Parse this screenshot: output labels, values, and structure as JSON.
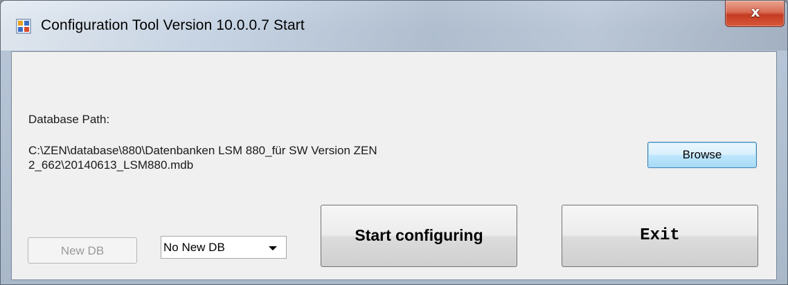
{
  "window": {
    "title": "Configuration Tool Version 10.0.0.7 Start",
    "app_icon": "app-window-icon",
    "close_icon": "close-icon",
    "close_glyph": "x"
  },
  "main": {
    "database_path_label": "Database Path:",
    "database_path_value": "C:\\ZEN\\database\\880\\Datenbanken LSM 880_für SW Version ZEN 2_662\\20140613_LSM880.mdb",
    "browse_label": "Browse",
    "start_label": "Start configuring",
    "exit_label": "Exit",
    "new_db_label": "New DB",
    "new_db_enabled": false,
    "db_mode_select": {
      "selected": "No New DB"
    }
  },
  "colors": {
    "client_background": "#f0f0f0",
    "focused_button_border": "#3c7fb1",
    "close_button": "#c43c22"
  }
}
